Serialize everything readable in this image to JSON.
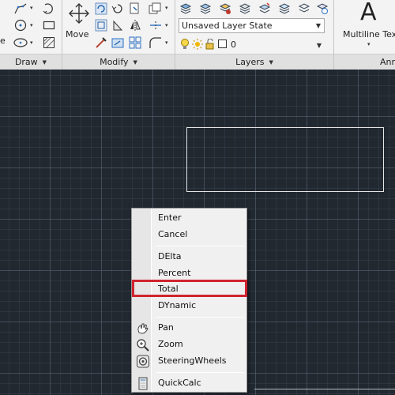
{
  "ribbon": {
    "draw_label": "Draw",
    "modify_label": "Modify",
    "layers_label": "Layers",
    "annotation_label": "Ann",
    "move_label": "Move",
    "layer_state": "Unsaved Layer State",
    "layer_current": "0",
    "multiline_text_label": "Multiline Text",
    "multiline_text_glyph": "A",
    "left_clip_text": "e"
  },
  "context_menu": {
    "items": [
      {
        "label": "Enter",
        "icon": ""
      },
      {
        "label": "Cancel",
        "icon": ""
      },
      {
        "label": "DElta",
        "icon": ""
      },
      {
        "label": "Percent",
        "icon": ""
      },
      {
        "label": "Total",
        "icon": "",
        "highlighted": true
      },
      {
        "label": "DYnamic",
        "icon": ""
      },
      {
        "label": "Pan",
        "icon": "pan-icon"
      },
      {
        "label": "Zoom",
        "icon": "zoom-icon"
      },
      {
        "label": "SteeringWheels",
        "icon": "steering-wheels-icon"
      },
      {
        "label": "QuickCalc",
        "icon": "calculator-icon"
      }
    ]
  },
  "colors": {
    "canvas": "#212830",
    "highlight_border": "#d0242f",
    "ribbon": "#f3f3f3"
  }
}
